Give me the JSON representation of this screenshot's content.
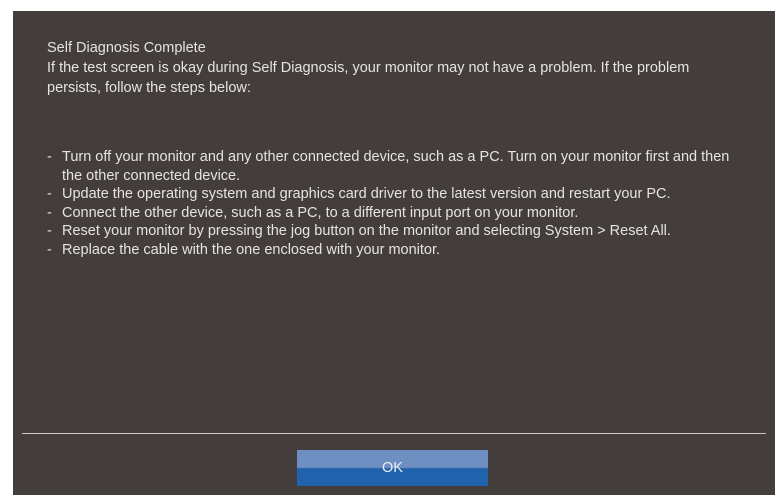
{
  "dialog": {
    "title": "Self Diagnosis Complete",
    "intro": "If the test screen is okay during Self Diagnosis, your monitor may not have a problem. If the problem persists, follow the steps below:",
    "bullet": "-",
    "steps": [
      "Turn off your monitor and any other connected device, such as a PC. Turn on your monitor first and then the other connected device.",
      "Update the operating system and graphics card driver to the latest version and restart your PC.",
      "Connect the other device, such as a PC, to a different input port on your monitor.",
      "Reset your monitor by pressing the jog button on the monitor and selecting System > Reset All.",
      "Replace the cable with the one enclosed with your monitor."
    ],
    "ok_label": "OK"
  },
  "colors": {
    "background": "#433e3b",
    "text": "#e6e3e0",
    "button_top": "#6f8fc3",
    "button_bottom": "#2162ad"
  }
}
